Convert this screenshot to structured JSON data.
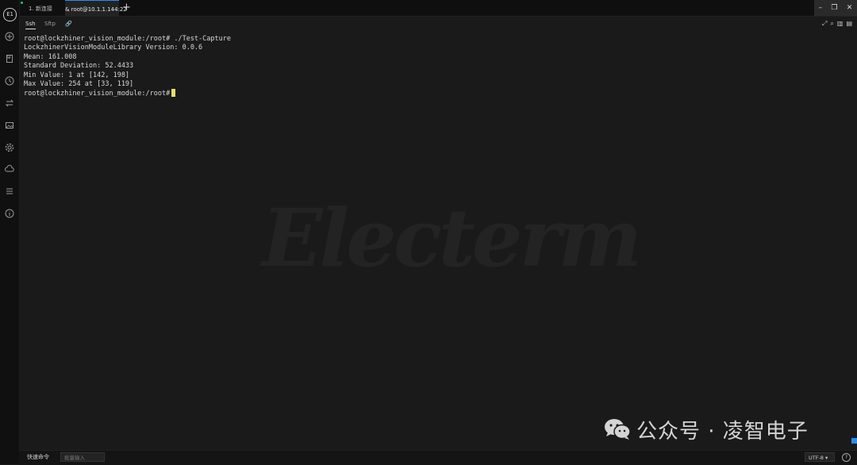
{
  "tabs": [
    {
      "label": "1. 新连接",
      "active": false
    },
    {
      "label": "& root@10.1.1.144:22",
      "active": true
    }
  ],
  "tab_add": "+",
  "window_controls": {
    "minimize": "–",
    "restore": "❐",
    "close": "✕"
  },
  "app_logo": "E1",
  "sidebar_icons": [
    "add-icon",
    "bookmark-icon",
    "history-icon",
    "transfer-icon",
    "image-icon",
    "settings-icon",
    "cloud-sync-icon",
    "list-icon",
    "info-icon"
  ],
  "subtabs": {
    "ssh": "Ssh",
    "sftp": "Sftp",
    "link": "🔗"
  },
  "terminal": {
    "lines": [
      "root@lockzhiner_vision_module:/root# ./Test-Capture",
      "LockzhinerVisionModuleLibrary Version: 0.0.6",
      "Mean: 161.008",
      "Standard Deviation: 52.4433",
      "Min Value: 1 at [142, 198]",
      "Max Value: 254 at [33, 119]"
    ],
    "prompt": "root@lockzhiner_vision_module:/root#"
  },
  "watermark": {
    "brand": "Electerm",
    "wechat_text": "公众号 · 凌智电子"
  },
  "bottom_bar": {
    "quick_command_label": "快速命令",
    "quick_command_placeholder": "批量输入",
    "encoding": "UTF-8 ▾",
    "help": "?"
  },
  "colors": {
    "accent": "#2d8cf0",
    "cursor": "#e8e066",
    "status_dot": "#26c76b"
  }
}
